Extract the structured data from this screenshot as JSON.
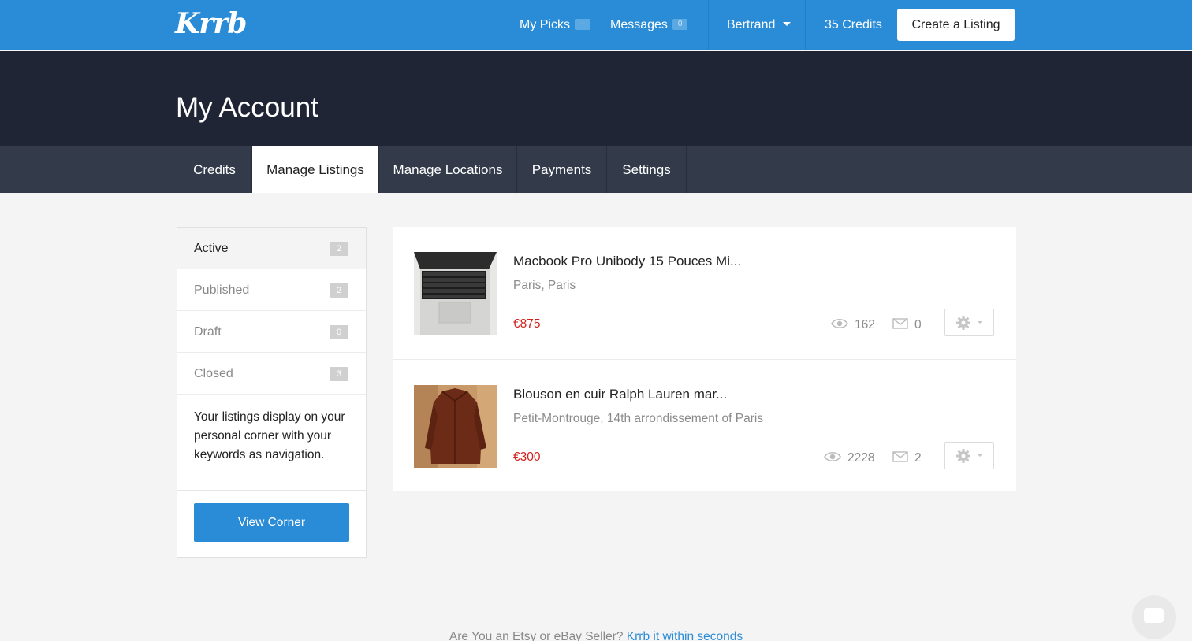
{
  "brand": {
    "logo": "Krrb"
  },
  "topnav": {
    "my_picks": {
      "label": "My Picks",
      "badge": "–"
    },
    "messages": {
      "label": "Messages",
      "badge": "0"
    },
    "user": {
      "label": "Bertrand"
    },
    "credits": "35 Credits",
    "create_listing": "Create a Listing"
  },
  "page": {
    "title": "My Account"
  },
  "tabs": [
    {
      "label": "Credits",
      "active": false
    },
    {
      "label": "Manage Listings",
      "active": true
    },
    {
      "label": "Manage Locations",
      "active": false
    },
    {
      "label": "Payments",
      "active": false
    },
    {
      "label": "Settings",
      "active": false
    }
  ],
  "sidebar": {
    "items": [
      {
        "label": "Active",
        "count": "2",
        "active": true
      },
      {
        "label": "Published",
        "count": "2",
        "active": false
      },
      {
        "label": "Draft",
        "count": "0",
        "active": false
      },
      {
        "label": "Closed",
        "count": "3",
        "active": false
      }
    ],
    "description": "Your listings display on your personal corner with your keywords as navigation.",
    "view_corner": "View Corner"
  },
  "listings": [
    {
      "title": "Macbook Pro Unibody 15 Pouces Mi...",
      "location": "Paris, Paris",
      "price": "€875",
      "views": "162",
      "messages": "0",
      "image_icon": "laptop-keyboard-photo"
    },
    {
      "title": "Blouson en cuir Ralph Lauren mar...",
      "location": "Petit-Montrouge, 14th arrondissement of Paris",
      "price": "€300",
      "views": "2228",
      "messages": "2",
      "image_icon": "leather-jacket-photo"
    }
  ],
  "footer": {
    "text": "Are You an Etsy or eBay Seller?",
    "link": "Krrb it within seconds"
  },
  "colors": {
    "primary": "#2a8cd6",
    "header_dark": "#1f2535",
    "tabs_bg": "#333b4b",
    "price": "#d0211c"
  }
}
